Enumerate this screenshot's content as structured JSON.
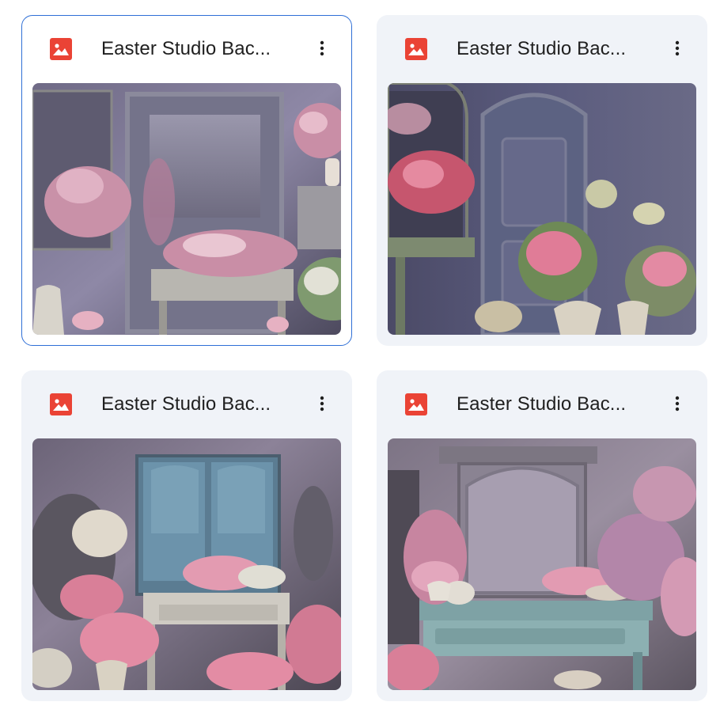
{
  "files": [
    {
      "name": "Easter Studio Bac...",
      "selected": true,
      "type_icon": "image-file-icon",
      "menu_icon": "more-vert-icon"
    },
    {
      "name": "Easter Studio Bac...",
      "selected": false,
      "type_icon": "image-file-icon",
      "menu_icon": "more-vert-icon"
    },
    {
      "name": "Easter Studio Bac...",
      "selected": false,
      "type_icon": "image-file-icon",
      "menu_icon": "more-vert-icon"
    },
    {
      "name": "Easter Studio Bac...",
      "selected": false,
      "type_icon": "image-file-icon",
      "menu_icon": "more-vert-icon"
    }
  ],
  "colors": {
    "selection_border": "#2f6fd6",
    "card_background": "#f0f3f8",
    "image_icon_red": "#ea4335"
  }
}
